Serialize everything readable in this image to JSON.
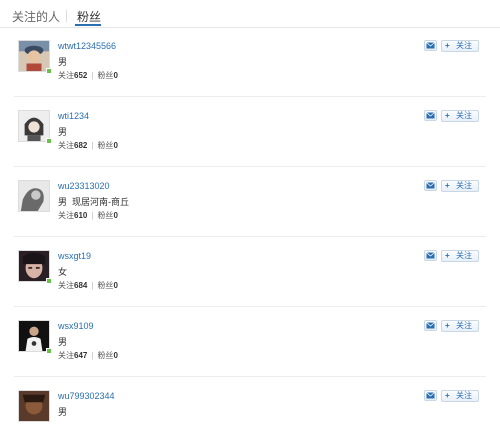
{
  "tabs": [
    {
      "label": "关注的人"
    },
    {
      "label": "粉丝"
    }
  ],
  "rows": [
    {
      "name": "wtwt12345566",
      "gender": "男",
      "location": "",
      "follow_label": "关注",
      "follow_count": "652",
      "fans_label": "粉丝",
      "fans_count": "0",
      "action": "关注"
    },
    {
      "name": "wti1234",
      "gender": "男",
      "location": "",
      "follow_label": "关注",
      "follow_count": "682",
      "fans_label": "粉丝",
      "fans_count": "0",
      "action": "关注"
    },
    {
      "name": "wu23313020",
      "gender": "男",
      "location": "现居河南-商丘",
      "follow_label": "关注",
      "follow_count": "610",
      "fans_label": "粉丝",
      "fans_count": "0",
      "action": "关注"
    },
    {
      "name": "wsxgt19",
      "gender": "女",
      "location": "",
      "follow_label": "关注",
      "follow_count": "684",
      "fans_label": "粉丝",
      "fans_count": "0",
      "action": "关注"
    },
    {
      "name": "wsx9109",
      "gender": "男",
      "location": "",
      "follow_label": "关注",
      "follow_count": "647",
      "fans_label": "粉丝",
      "fans_count": "0",
      "action": "关注"
    },
    {
      "name": "wu799302344",
      "gender": "男",
      "location": "",
      "follow_label": "关注",
      "follow_count": "",
      "fans_label": "",
      "fans_count": "",
      "action": "关注"
    }
  ],
  "icons": {
    "message": "envelope-icon",
    "plus": "plus-icon",
    "online": "online-status-icon"
  },
  "colors": {
    "link": "#2a6fb0",
    "online": "#6ac14a"
  }
}
